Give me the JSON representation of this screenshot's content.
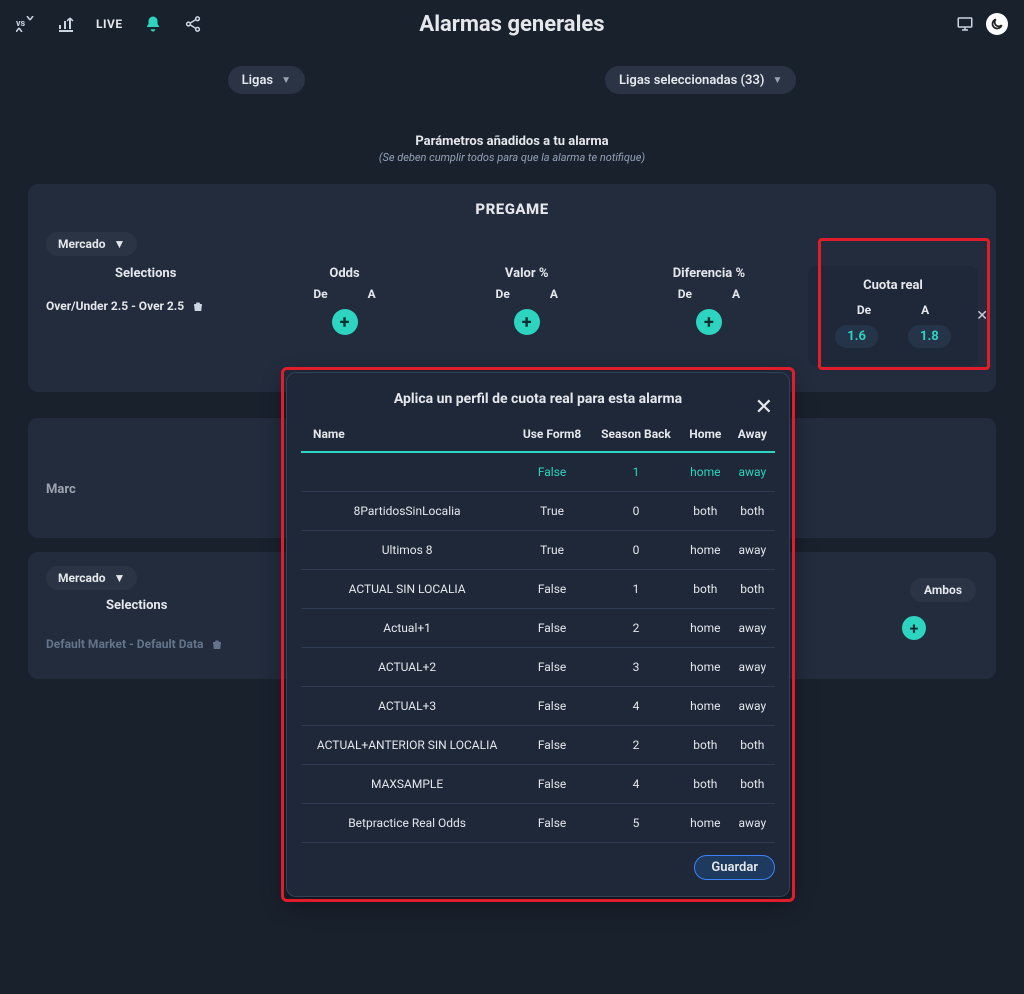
{
  "header": {
    "live": "LIVE",
    "title": "Alarmas generales"
  },
  "filters": {
    "leagues_label": "Ligas",
    "selected_label": "Ligas seleccionadas (33)"
  },
  "subtitle": {
    "line1": "Parámetros añadidos a tu alarma",
    "line2": "(Se deben cumplir todos para que la alarma te notifique)"
  },
  "pregame": {
    "title": "PREGAME",
    "market_label": "Mercado",
    "columns": {
      "selections": "Selections",
      "odds": "Odds",
      "valor": "Valor %",
      "diferencia": "Diferencia %",
      "cuota_real": "Cuota real",
      "de": "De",
      "a": "A"
    },
    "selection_value": "Over/Under 2.5 - Over 2.5",
    "cuota_de": "1.6",
    "cuota_a": "1.8"
  },
  "panel2_stub": "Marc",
  "panel3": {
    "market_label": "Mercado",
    "selections": "Selections",
    "default_row": "Default Market - Default Data",
    "ambos": "Ambos"
  },
  "modal": {
    "title": "Aplica un perfil de cuota real para esta alarma",
    "columns": {
      "name": "Name",
      "use_form8": "Use Form8",
      "season_back": "Season Back",
      "home": "Home",
      "away": "Away"
    },
    "rows": [
      {
        "name": "",
        "use_form8": "False",
        "season_back": "1",
        "home": "home",
        "away": "away",
        "selected": true
      },
      {
        "name": "8PartidosSinLocalia",
        "use_form8": "True",
        "season_back": "0",
        "home": "both",
        "away": "both"
      },
      {
        "name": "Ultimos 8",
        "use_form8": "True",
        "season_back": "0",
        "home": "home",
        "away": "away"
      },
      {
        "name": "ACTUAL SIN LOCALIA",
        "use_form8": "False",
        "season_back": "1",
        "home": "both",
        "away": "both"
      },
      {
        "name": "Actual+1",
        "use_form8": "False",
        "season_back": "2",
        "home": "home",
        "away": "away"
      },
      {
        "name": "ACTUAL+2",
        "use_form8": "False",
        "season_back": "3",
        "home": "home",
        "away": "away"
      },
      {
        "name": "ACTUAL+3",
        "use_form8": "False",
        "season_back": "4",
        "home": "home",
        "away": "away"
      },
      {
        "name": "ACTUAL+ANTERIOR SIN LOCALIA",
        "use_form8": "False",
        "season_back": "2",
        "home": "both",
        "away": "both"
      },
      {
        "name": "MAXSAMPLE",
        "use_form8": "False",
        "season_back": "4",
        "home": "both",
        "away": "both"
      },
      {
        "name": "Betpractice Real Odds",
        "use_form8": "False",
        "season_back": "5",
        "home": "home",
        "away": "away"
      }
    ],
    "save": "Guardar"
  }
}
